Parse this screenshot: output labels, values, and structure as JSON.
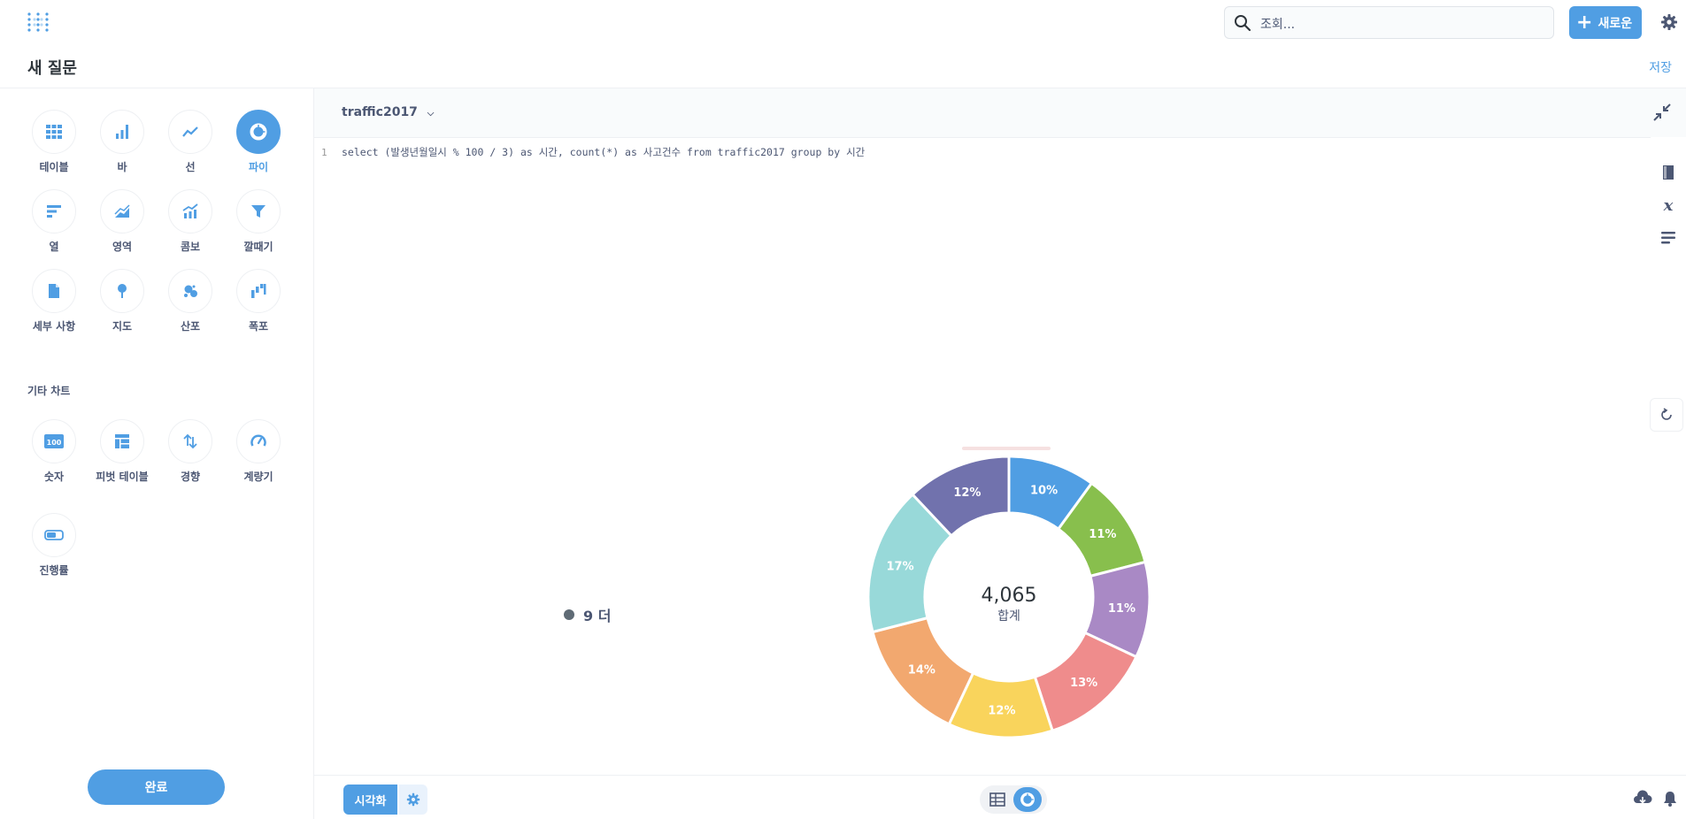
{
  "header": {
    "search_placeholder": "조회...",
    "new_label": "새로운"
  },
  "titlebar": {
    "title": "새 질문",
    "save_label": "저장"
  },
  "sidebar": {
    "viz_types": [
      {
        "label": "테이블",
        "icon": "table-icon"
      },
      {
        "label": "바",
        "icon": "bar-icon"
      },
      {
        "label": "선",
        "icon": "line-icon"
      },
      {
        "label": "파이",
        "icon": "pie-icon",
        "active": true
      },
      {
        "label": "열",
        "icon": "row-icon"
      },
      {
        "label": "영역",
        "icon": "area-icon"
      },
      {
        "label": "콤보",
        "icon": "combo-icon"
      },
      {
        "label": "깔때기",
        "icon": "funnel-icon"
      },
      {
        "label": "세부 사항",
        "icon": "detail-icon"
      },
      {
        "label": "지도",
        "icon": "map-pin-icon"
      },
      {
        "label": "산포",
        "icon": "scatter-icon"
      },
      {
        "label": "폭포",
        "icon": "waterfall-icon"
      }
    ],
    "other_title": "기타 차트",
    "other_types": [
      {
        "label": "숫자",
        "icon": "number-icon"
      },
      {
        "label": "피벗 테이블",
        "icon": "pivot-icon"
      },
      {
        "label": "경향",
        "icon": "trend-icon"
      },
      {
        "label": "계량기",
        "icon": "gauge-icon"
      },
      {
        "label": "진행률",
        "icon": "progress-icon"
      }
    ],
    "done_label": "완료"
  },
  "editor": {
    "database": "traffic2017",
    "line_number": "1",
    "sql": "select (발생년월일시 % 100 / 3) as 시간, count(*) as 사고건수 from traffic2017 group by 시간"
  },
  "results": {
    "legend_label": "9 더",
    "total_value": "4,065",
    "total_label": "합계"
  },
  "footer": {
    "viz_label": "시각화"
  },
  "colors": {
    "accent": "#509ee3"
  },
  "chart_data": {
    "type": "pie",
    "donut": true,
    "total": "4,065",
    "total_label": "합계",
    "slices": [
      {
        "label": "10%",
        "percent": 10,
        "color": "#509ee3"
      },
      {
        "label": "11%",
        "percent": 11,
        "color": "#88bf4d"
      },
      {
        "label": "11%",
        "percent": 11,
        "color": "#a989c5"
      },
      {
        "label": "13%",
        "percent": 13,
        "color": "#ef8c8c"
      },
      {
        "label": "12%",
        "percent": 12,
        "color": "#f9d45c"
      },
      {
        "label": "14%",
        "percent": 14,
        "color": "#f2a86f"
      },
      {
        "label": "17%",
        "percent": 17,
        "color": "#98d9d9"
      },
      {
        "label": "12%",
        "percent": 12,
        "color": "#7172ad"
      }
    ]
  }
}
